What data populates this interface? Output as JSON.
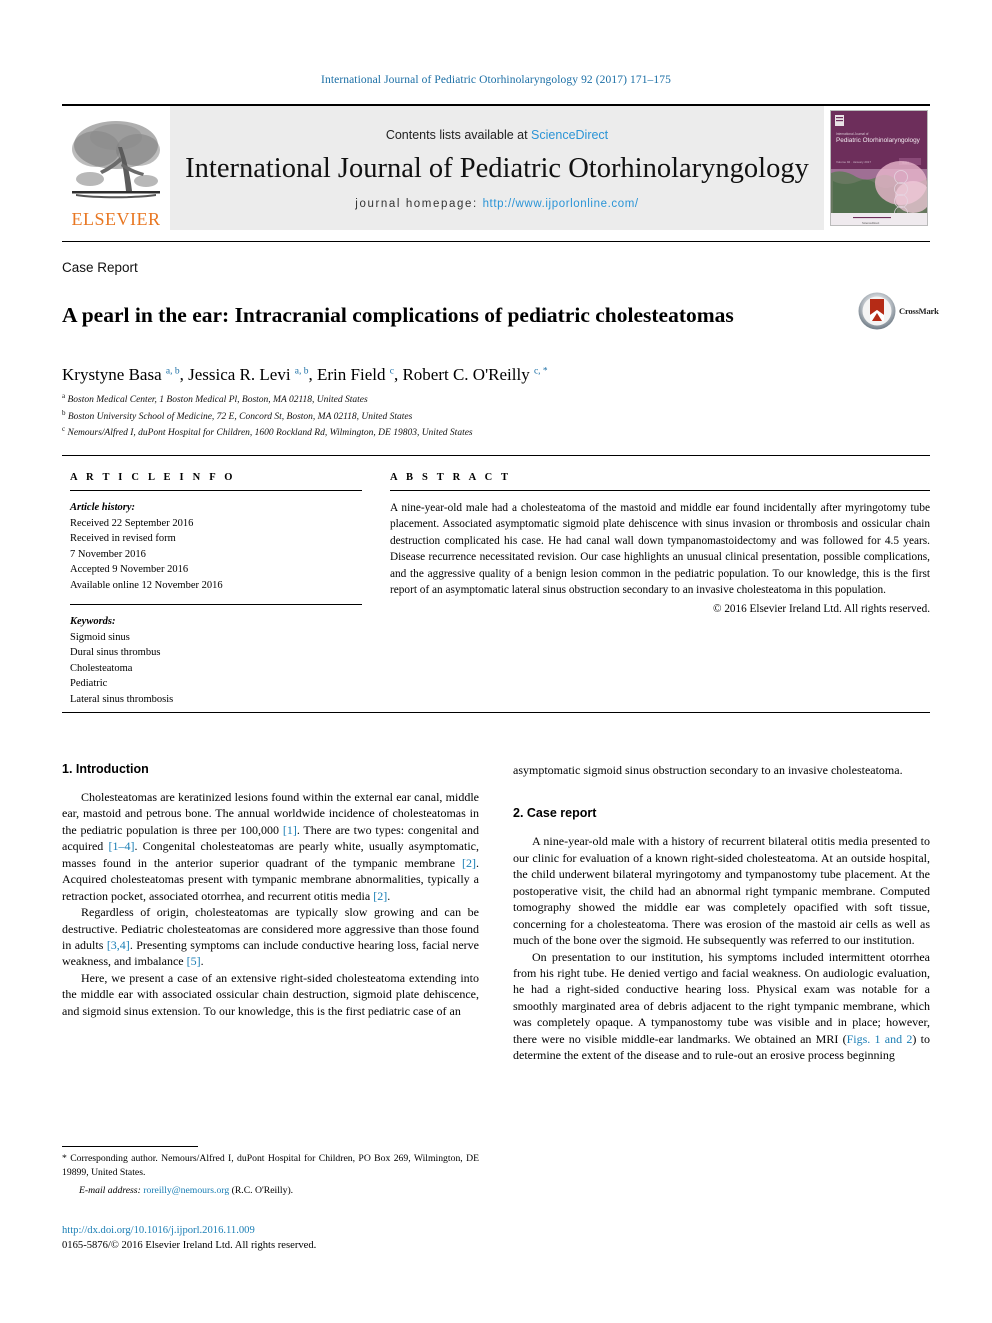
{
  "running_head": "International Journal of Pediatric Otorhinolaryngology 92 (2017) 171–175",
  "masthead": {
    "publisher_name": "ELSEVIER",
    "contents_prefix": "Contents lists available at ",
    "sciencedirect": "ScienceDirect",
    "journal_title": "International Journal of Pediatric Otorhinolaryngology",
    "homepage_label": "journal homepage: ",
    "homepage_url": "http://www.ijporlonline.com/",
    "cover_title_small": "International Journal of",
    "cover_title": "Pediatric Otorhinolaryngology",
    "accent_sciencedirect": "#2a94d6",
    "accent_elsevier": "#E87722",
    "cover_bg": "#6d2e5b"
  },
  "article": {
    "doctype": "Case Report",
    "title": "A pearl in the ear: Intracranial complications of pediatric cholesteatomas",
    "crossmark_label": "CrossMark",
    "authors_html": "Krystyne Basa <sup>a, b</sup>, Jessica R. Levi <sup>a, b</sup>, Erin Field <sup>c</sup>, Robert C. O'Reilly <sup>c, *</sup>",
    "affiliations": [
      {
        "mark": "a",
        "text": "Boston Medical Center, 1 Boston Medical Pl, Boston, MA 02118, United States"
      },
      {
        "mark": "b",
        "text": "Boston University School of Medicine, 72 E, Concord St, Boston, MA 02118, United States"
      },
      {
        "mark": "c",
        "text": "Nemours/Alfred I, duPont Hospital for Children, 1600 Rockland Rd, Wilmington, DE 19803, United States"
      }
    ]
  },
  "article_info": {
    "heading": "A R T I C L E   I N F O",
    "history_label": "Article history:",
    "history": [
      "Received 22 September 2016",
      "Received in revised form",
      "7 November 2016",
      "Accepted 9 November 2016",
      "Available online 12 November 2016"
    ],
    "keywords_label": "Keywords:",
    "keywords": [
      "Sigmoid sinus",
      "Dural sinus thrombus",
      "Cholesteatoma",
      "Pediatric",
      "Lateral sinus thrombosis"
    ]
  },
  "abstract": {
    "heading": "A B S T R A C T",
    "text": "A nine-year-old male had a cholesteatoma of the mastoid and middle ear found incidentally after myringotomy tube placement. Associated asymptomatic sigmoid plate dehiscence with sinus invasion or thrombosis and ossicular chain destruction complicated his case. He had canal wall down tympanomastoidectomy and was followed for 4.5 years. Disease recurrence necessitated revision. Our case highlights an unusual clinical presentation, possible complications, and the aggressive quality of a benign lesion common in the pediatric population. To our knowledge, this is the first report of an asymptomatic lateral sinus obstruction secondary to an invasive cholesteatoma in this population.",
    "copyright": "© 2016 Elsevier Ireland Ltd. All rights reserved."
  },
  "body": {
    "left": {
      "section_heading": "1.  Introduction",
      "p1_pre": "Cholesteatomas are keratinized lesions found within the external ear canal, middle ear, mastoid and petrous bone. The annual worldwide incidence of cholesteatomas in the pediatric population is three per 100,000 ",
      "p1_ref1": "[1]",
      "p1_mid1": ". There are two types: congenital and acquired ",
      "p1_ref2": "[1–4]",
      "p1_mid2": ". Congenital cholesteatomas are pearly white, usually asymptomatic, masses found in the anterior superior quadrant of the tympanic membrane ",
      "p1_ref3": "[2]",
      "p1_mid3": ". Acquired cholesteatomas present with tympanic membrane abnormalities, typically a retraction pocket, associated otorrhea, and recurrent otitis media ",
      "p1_ref4": "[2]",
      "p1_end": ".",
      "p2_pre": "Regardless of origin, cholesteatomas are typically slow growing and can be destructive. Pediatric cholesteatomas are considered more aggressive than those found in adults ",
      "p2_ref1": "[3,4]",
      "p2_mid1": ". Presenting symptoms can include conductive hearing loss, facial nerve weakness, and imbalance ",
      "p2_ref2": "[5]",
      "p2_end": ".",
      "p3": "Here, we present a case of an extensive right-sided cholesteatoma extending into the middle ear with associated ossicular chain destruction, sigmoid plate dehiscence, and sigmoid sinus extension. To our knowledge, this is the first pediatric case of an"
    },
    "right": {
      "continuation": "asymptomatic sigmoid sinus obstruction secondary to an invasive cholesteatoma.",
      "section_heading": "2.  Case report",
      "p1": "A nine-year-old male with a history of recurrent bilateral otitis media presented to our clinic for evaluation of a known right-sided cholesteatoma. At an outside hospital, the child underwent bilateral myringotomy and tympanostomy tube placement. At the postoperative visit, the child had an abnormal right tympanic membrane. Computed tomography showed the middle ear was completely opacified with soft tissue, concerning for a cholesteatoma. There was erosion of the mastoid air cells as well as much of the bone over the sigmoid. He subsequently was referred to our institution.",
      "p2_pre": "On presentation to our institution, his symptoms included intermittent otorrhea from his right tube. He denied vertigo and facial weakness. On audiologic evaluation, he had a right-sided conductive hearing loss. Physical exam was notable for a smoothly marginated area of debris adjacent to the right tympanic membrane, which was completely opaque. A tympanostomy tube was visible and in place; however, there were no visible middle-ear landmarks. We obtained an MRI (",
      "p2_ref": "Figs. 1 and 2",
      "p2_post": ") to determine the extent of the disease and to rule-out an erosive process beginning"
    }
  },
  "footnotes": {
    "corresponding_mark": "*",
    "corresponding_text": " Corresponding author. Nemours/Alfred I, duPont Hospital for Children, PO Box 269, Wilmington, DE 19899, United States.",
    "email_label": "E-mail address:",
    "email": "roreilly@nemours.org",
    "email_owner": "(R.C. O'Reilly).",
    "doi": "http://dx.doi.org/10.1016/j.ijporl.2016.11.009",
    "issn_line": "0165-5876/© 2016 Elsevier Ireland Ltd. All rights reserved."
  }
}
